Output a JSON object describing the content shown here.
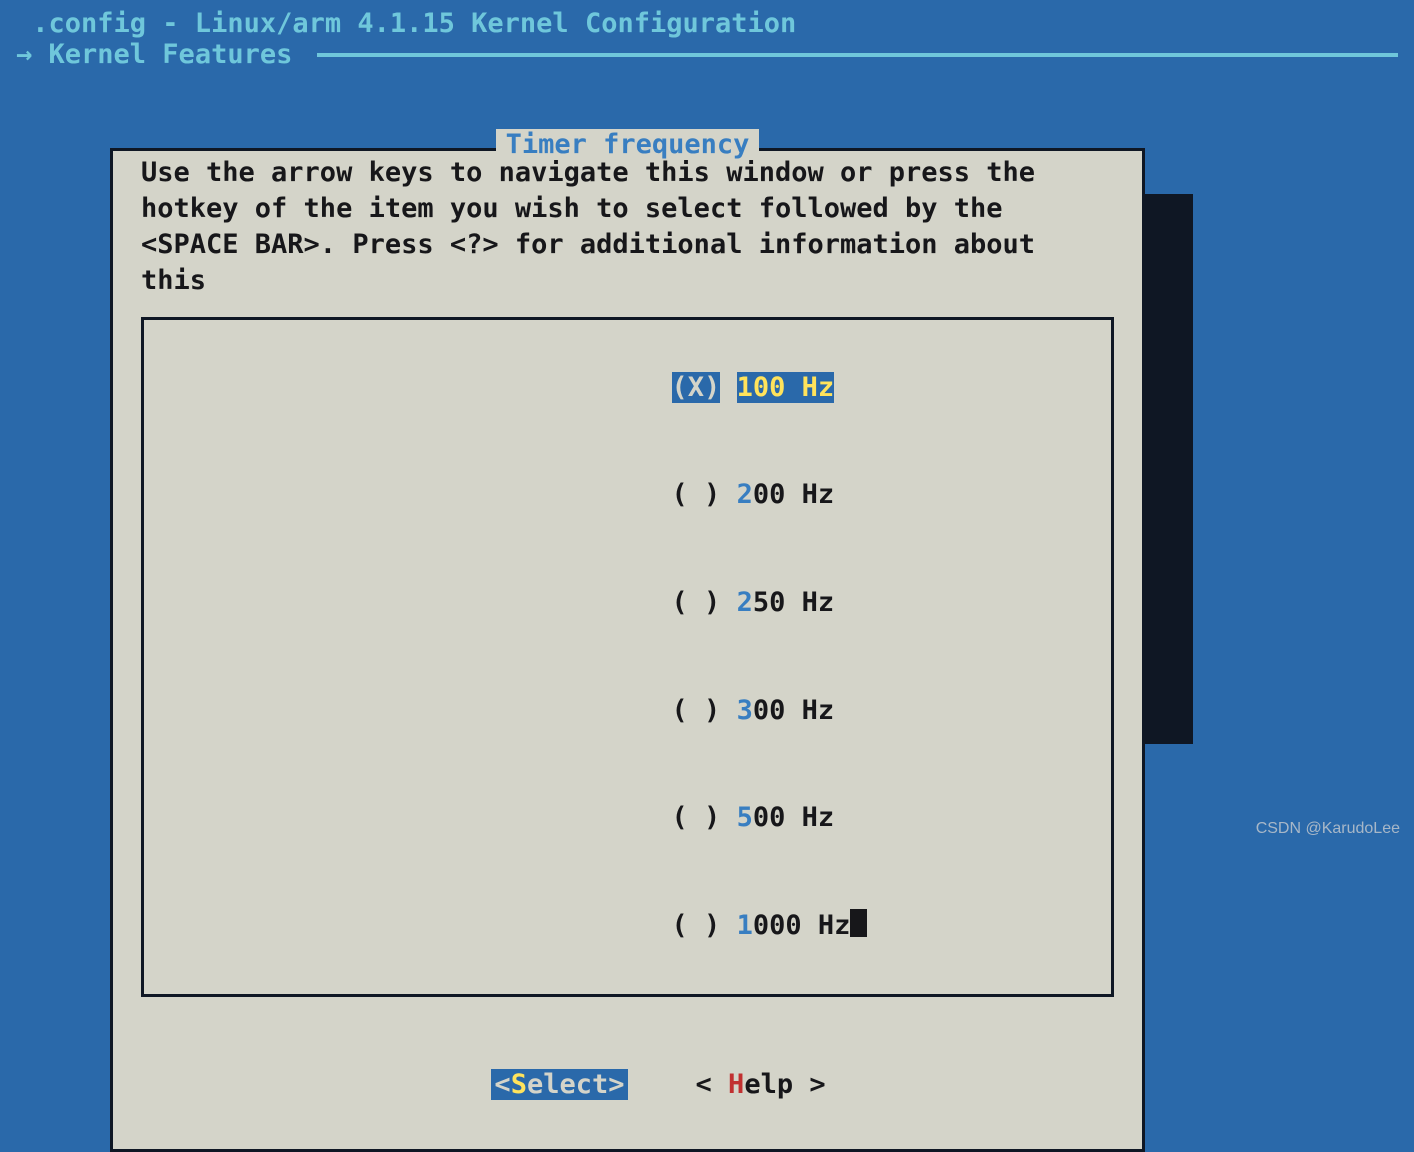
{
  "header": {
    "title": " .config - Linux/arm 4.1.15 Kernel Configuration",
    "breadcrumb_arrow": "→ ",
    "breadcrumb": "Kernel Features "
  },
  "dialog": {
    "title": " Timer frequency ",
    "hint": "Use the arrow keys to navigate this window or press the hotkey of the item you wish to select followed by the <SPACE BAR>. Press <?> for additional information about this",
    "options": [
      {
        "marker": "(X)",
        "hot": "1",
        "rest": "00 Hz",
        "selected": true
      },
      {
        "marker": "( )",
        "hot": "2",
        "rest": "00 Hz",
        "selected": false
      },
      {
        "marker": "( )",
        "hot": "2",
        "rest": "50 Hz",
        "selected": false
      },
      {
        "marker": "( )",
        "hot": "3",
        "rest": "00 Hz",
        "selected": false
      },
      {
        "marker": "( )",
        "hot": "5",
        "rest": "00 Hz",
        "selected": false
      },
      {
        "marker": "( )",
        "hot": "1",
        "rest": "000 Hz",
        "selected": false
      }
    ],
    "buttons": {
      "select": {
        "open": "<",
        "hot": "S",
        "rest": "elect",
        "close": ">",
        "active": true
      },
      "help": {
        "open": "< ",
        "hot": "H",
        "rest": "elp",
        "close": " >",
        "active": false
      }
    }
  },
  "watermark": "CSDN @KarudoLee"
}
